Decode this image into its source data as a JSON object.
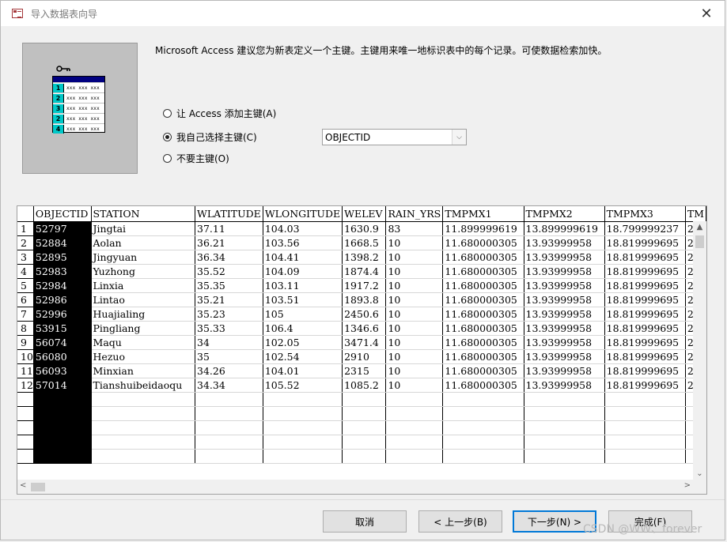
{
  "window": {
    "title": "导入数据表向导",
    "close_glyph": "✕"
  },
  "description": "Microsoft Access 建议您为新表定义一个主键。主键用来唯一地标识表中的每个记录。可使数据检索加快。",
  "illustration": {
    "rows": [
      "1",
      "2",
      "3",
      "2",
      "4"
    ],
    "cell_text": "xxx xxx xxx"
  },
  "options": [
    {
      "label": "让 Access 添加主键(A)",
      "selected": false
    },
    {
      "label": "我自己选择主键(C)",
      "selected": true
    },
    {
      "label": "不要主键(O)",
      "selected": false
    }
  ],
  "primary_key_select": {
    "value": "OBJECTID",
    "arrow": "⌵"
  },
  "grid": {
    "columns": [
      "OBJECTID",
      "STATION",
      "WLATITUDE",
      "WLONGITUDE",
      "WELEV",
      "RAIN_YRS",
      "TMPMX1",
      "TMPMX2",
      "TMPMX3",
      "TM"
    ],
    "rows": [
      [
        "1",
        "52797",
        "Jingtai",
        "37.11",
        "104.03",
        "1630.9",
        "83",
        "11.899999619",
        "13.899999619",
        "18.799999237",
        "2"
      ],
      [
        "2",
        "52884",
        "Aolan",
        "36.21",
        "103.56",
        "1668.5",
        "10",
        "11.680000305",
        "13.93999958",
        "18.819999695",
        "2"
      ],
      [
        "3",
        "52895",
        "Jingyuan",
        "36.34",
        "104.41",
        "1398.2",
        "10",
        "11.680000305",
        "13.93999958",
        "18.819999695",
        "2"
      ],
      [
        "4",
        "52983",
        "Yuzhong",
        "35.52",
        "104.09",
        "1874.4",
        "10",
        "11.680000305",
        "13.93999958",
        "18.819999695",
        "2"
      ],
      [
        "5",
        "52984",
        "Linxia",
        "35.35",
        "103.11",
        "1917.2",
        "10",
        "11.680000305",
        "13.93999958",
        "18.819999695",
        "2"
      ],
      [
        "6",
        "52986",
        "Lintao",
        "35.21",
        "103.51",
        "1893.8",
        "10",
        "11.680000305",
        "13.93999958",
        "18.819999695",
        "2"
      ],
      [
        "7",
        "52996",
        "Huajialing",
        "35.23",
        "105",
        "2450.6",
        "10",
        "11.680000305",
        "13.93999958",
        "18.819999695",
        "2"
      ],
      [
        "8",
        "53915",
        "Pingliang",
        "35.33",
        "106.4",
        "1346.6",
        "10",
        "11.680000305",
        "13.93999958",
        "18.819999695",
        "2"
      ],
      [
        "9",
        "56074",
        "Maqu",
        "34",
        "102.05",
        "3471.4",
        "10",
        "11.680000305",
        "13.93999958",
        "18.819999695",
        "2"
      ],
      [
        "10",
        "56080",
        "Hezuo",
        "35",
        "102.54",
        "2910",
        "10",
        "11.680000305",
        "13.93999958",
        "18.819999695",
        "2"
      ],
      [
        "11",
        "56093",
        "Minxian",
        "34.26",
        "104.01",
        "2315",
        "10",
        "11.680000305",
        "13.93999958",
        "18.819999695",
        "2"
      ],
      [
        "12",
        "57014",
        "Tianshuibeidaoqu",
        "34.34",
        "105.52",
        "1085.2",
        "10",
        "11.680000305",
        "13.93999958",
        "18.819999695",
        "2"
      ]
    ],
    "empty_rows": 5
  },
  "scroll_glyphs": {
    "up": "▲",
    "down": "⌄",
    "left": "<",
    "right": ">"
  },
  "buttons": {
    "cancel": "取消",
    "back": "< 上一步(B)",
    "next": "下一步(N) >",
    "finish": "完成(F)"
  },
  "watermark": "CSDN @WW、forever",
  "colors": {
    "pk_column_bg": "#000000",
    "pk_column_fg": "#ffffff",
    "default_button_border": "#0078d7",
    "illustration_header": "#000080",
    "illustration_row_number": "#00c8c8"
  }
}
